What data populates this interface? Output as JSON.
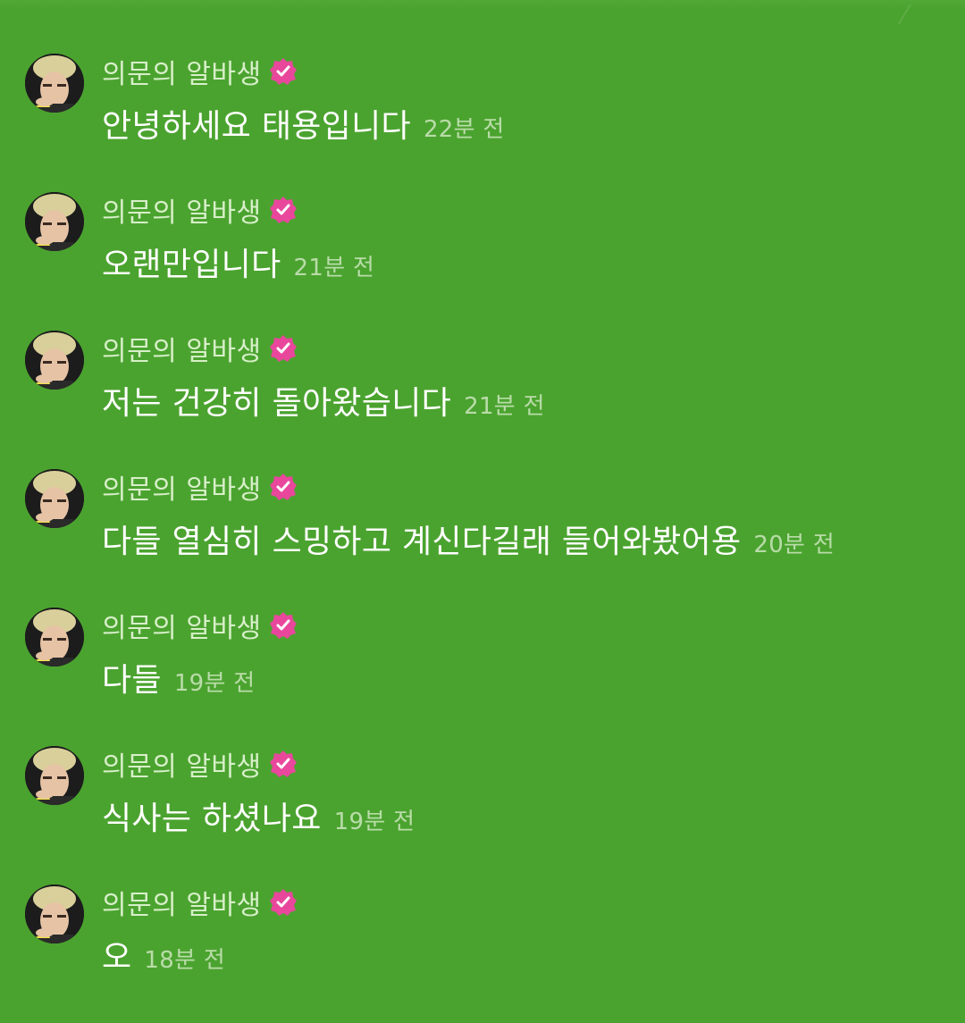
{
  "chat": {
    "messages": [
      {
        "sender": "의문의 알바생",
        "text": "안녕하세요 태용입니다",
        "time": "22분 전"
      },
      {
        "sender": "의문의 알바생",
        "text": "오랜만입니다",
        "time": "21분 전"
      },
      {
        "sender": "의문의 알바생",
        "text": "저는 건강히 돌아왔습니다",
        "time": "21분 전"
      },
      {
        "sender": "의문의 알바생",
        "text": "다들 열심히 스밍하고 계신다길래 들어와봤어용",
        "time": "20분 전"
      },
      {
        "sender": "의문의 알바생",
        "text": "다들",
        "time": "19분 전"
      },
      {
        "sender": "의문의 알바생",
        "text": "식사는 하셨나요",
        "time": "19분 전"
      },
      {
        "sender": "의문의 알바생",
        "text": "오",
        "time": "18분 전"
      }
    ]
  },
  "icons": {
    "avatar": "user-avatar",
    "badge": "verified-badge-icon"
  },
  "colors": {
    "background": "#4ba32f",
    "sender": "#d7efc9",
    "message": "#ffffff",
    "time": "#b9dca9",
    "badge": "#e8479c"
  }
}
